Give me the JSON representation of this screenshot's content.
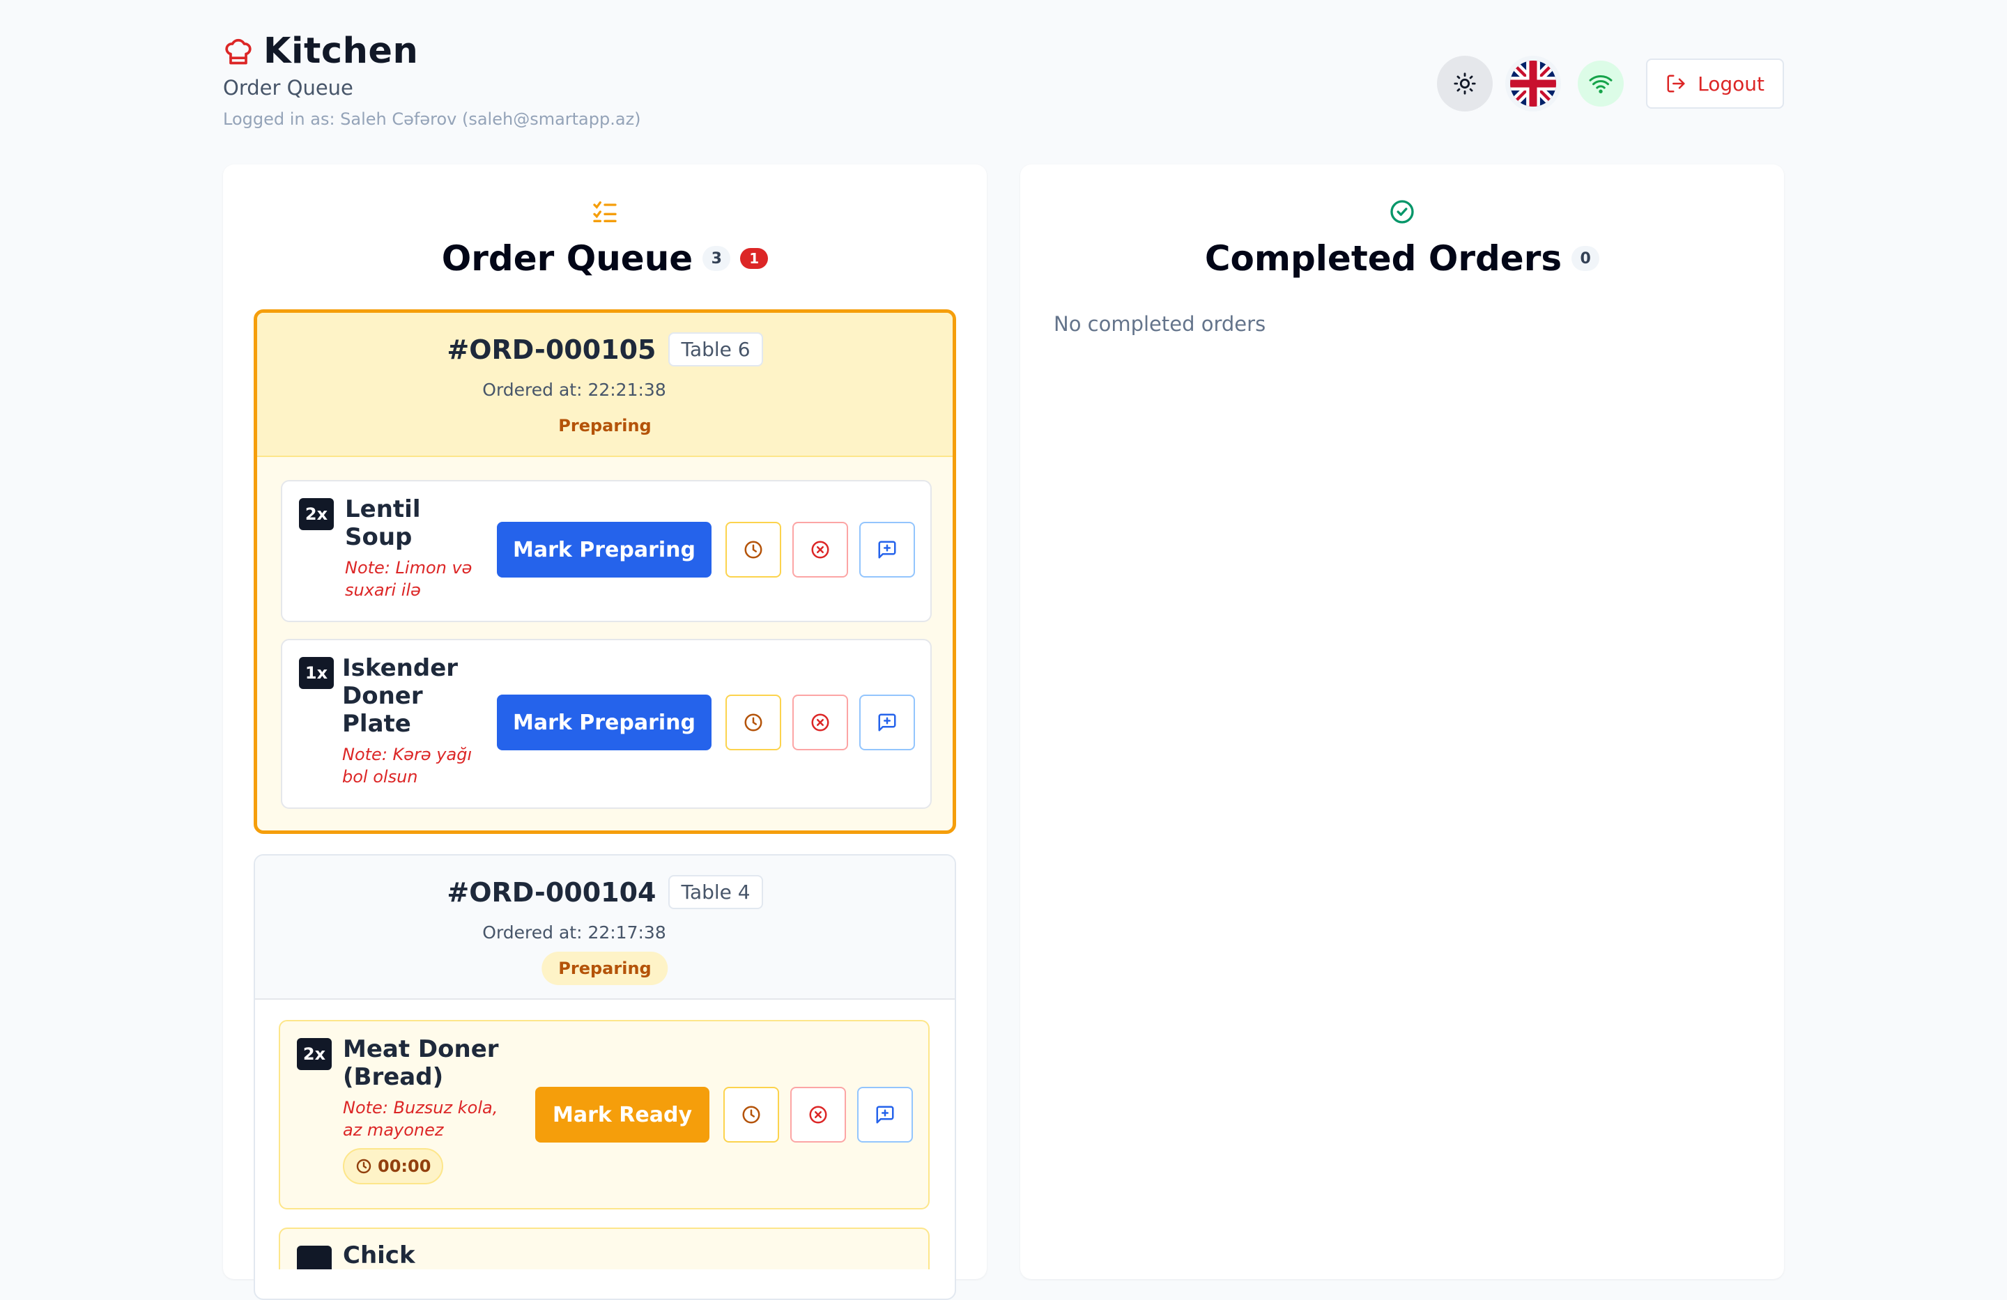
{
  "header": {
    "title": "Kitchen",
    "subtitle": "Order Queue",
    "logged_in": "Logged in as: Saleh Cəfərov (saleh@smartapp.az)",
    "logout_label": "Logout"
  },
  "queue": {
    "title": "Order Queue",
    "count": "3",
    "alert_count": "1",
    "orders": [
      {
        "id": "#ORD-000105",
        "table": "Table 6",
        "ordered_at": "Ordered at: 22:21:38",
        "status": "Preparing",
        "items": [
          {
            "qty": "2x",
            "name": "Lentil Soup",
            "note": "Note: Limon və suxari ilə",
            "action": "Mark Preparing"
          },
          {
            "qty": "1x",
            "name": "Iskender Doner Plate",
            "note": "Note: Kərə yağı bol olsun",
            "action": "Mark Preparing"
          }
        ]
      },
      {
        "id": "#ORD-000104",
        "table": "Table 4",
        "ordered_at": "Ordered at: 22:17:38",
        "status": "Preparing",
        "items": [
          {
            "qty": "2x",
            "name": "Meat Doner (Bread)",
            "note": "Note: Buzsuz kola, az mayonez",
            "action": "Mark Ready",
            "timer": "00:00"
          },
          {
            "qty": "",
            "name": "Chick"
          }
        ]
      }
    ]
  },
  "completed": {
    "title": "Completed Orders",
    "count": "0",
    "empty_text": "No completed orders"
  },
  "colors": {
    "accent": "#2563eb",
    "warning": "#f59e0b",
    "danger": "#dc2626",
    "success": "#16a34a"
  }
}
